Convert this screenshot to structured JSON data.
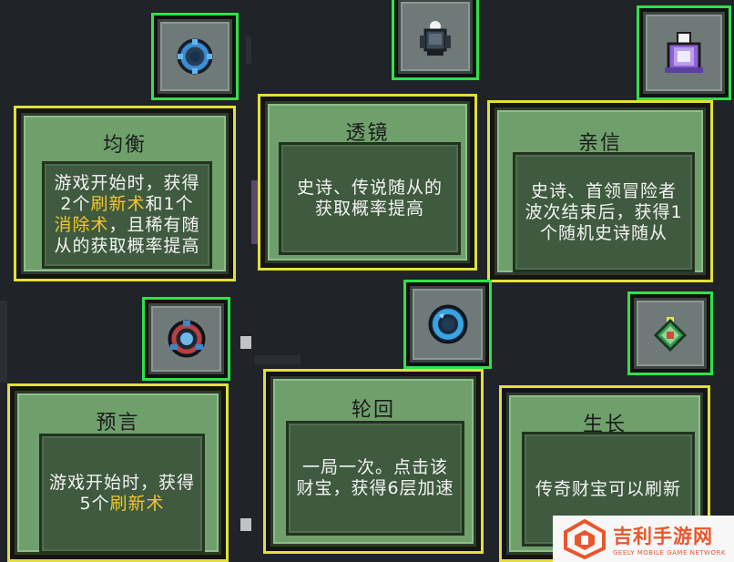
{
  "cards": [
    {
      "id": "balance",
      "title": "均衡",
      "desc_parts": [
        "游戏开始时，获得2个",
        "刷新术",
        "和1个",
        "消除术",
        "，且稀有随从的获取概率提高"
      ],
      "icon": "balance-ring-icon"
    },
    {
      "id": "lens",
      "title": "透镜",
      "desc_parts": [
        "史诗、传说随从的获取概率提高"
      ],
      "icon": "lens-statue-icon"
    },
    {
      "id": "confidant",
      "title": "亲信",
      "desc_parts": [
        "史诗、首领冒险者波次结束后，获得1个随机史诗随从"
      ],
      "icon": "confidant-banner-icon"
    },
    {
      "id": "prophecy",
      "title": "预言",
      "desc_parts": [
        "游戏开始时，获得5个",
        "刷新术"
      ],
      "icon": "prophecy-orb-icon"
    },
    {
      "id": "reincarnation",
      "title": "轮回",
      "desc_parts": [
        "一局一次。点击该财宝，获得6层加速"
      ],
      "icon": "reincarnation-ring-icon"
    },
    {
      "id": "growth",
      "title": "生长",
      "desc_parts": [
        "传奇财宝可以刷新"
      ],
      "icon": "growth-gem-icon"
    }
  ],
  "watermark": {
    "title": "吉利手游网",
    "subtitle": "GEELY MOBILE GAME NETWORK"
  },
  "colors": {
    "selected_border": "#2ee24a",
    "card_border": "#e3df3a",
    "highlight": "#f2c62f",
    "card_bg": "#6fa06c"
  }
}
